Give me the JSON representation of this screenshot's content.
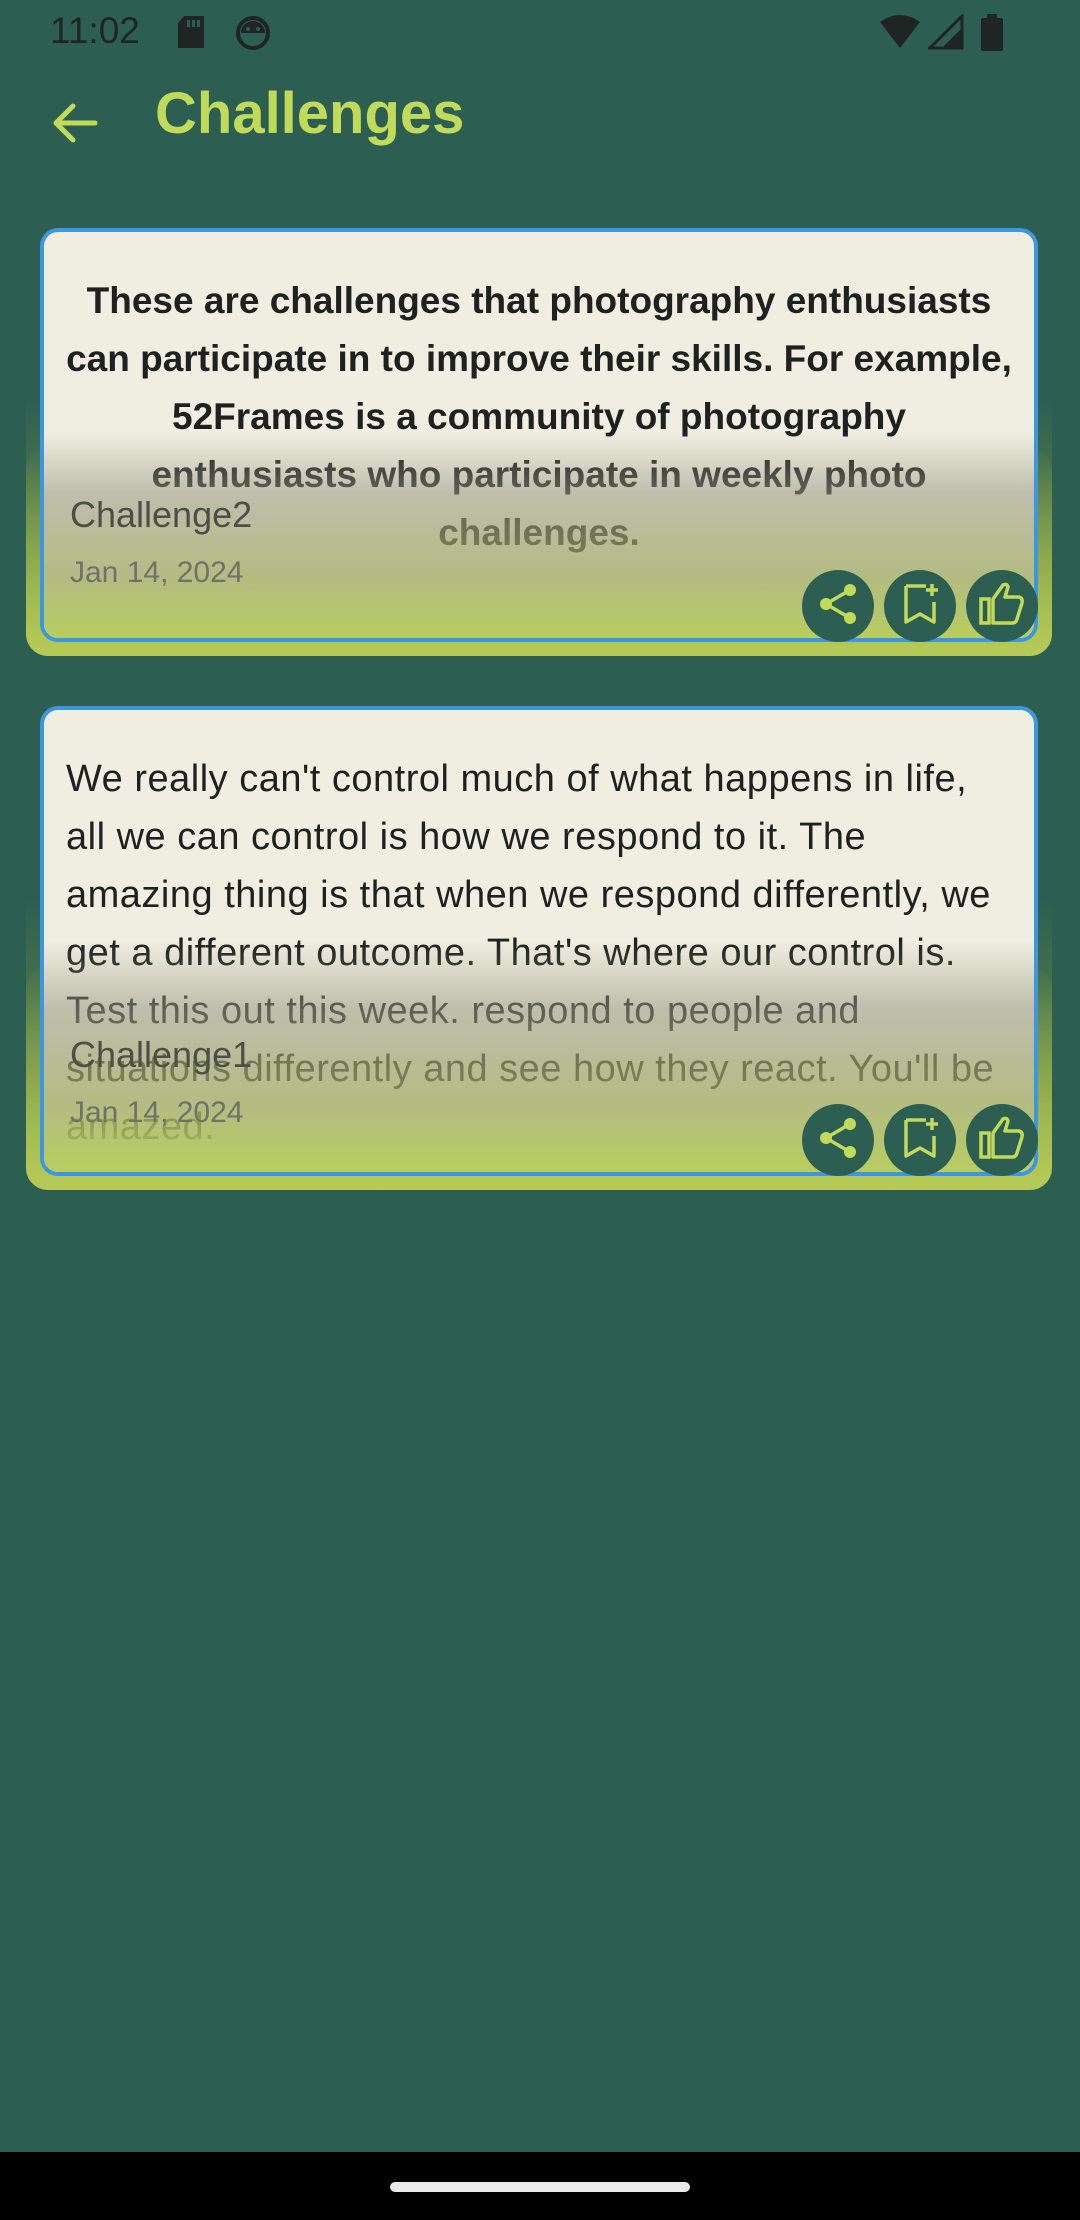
{
  "status_bar": {
    "time": "11:02",
    "icons": [
      "sd-card-icon",
      "android-debug-icon",
      "wifi-icon",
      "signal-icon",
      "battery-icon"
    ]
  },
  "app_bar": {
    "title": "Challenges",
    "back_icon": "arrow-left-icon"
  },
  "cards": [
    {
      "body": "These are challenges that photography enthusiasts can participate in to improve their skills. For example, 52Frames is a community of photography enthusiasts who participate in weekly photo challenges.",
      "title": "Challenge2",
      "date": "Jan 14, 2024",
      "actions": [
        "share-icon",
        "bookmark-add-icon",
        "thumb-up-icon"
      ]
    },
    {
      "body": "We really can't control much of what happens in life, all we can control is how we respond to it. The amazing thing is that when we respond differently, we get a different outcome. That's where our control is. Test this out this week. respond to people and situations differently and see how they react. You'll be amazed.",
      "title": "Challenge1",
      "date": "Jan 14, 2024",
      "actions": [
        "share-icon",
        "bookmark-add-icon",
        "thumb-up-icon"
      ]
    }
  ],
  "colors": {
    "background": "#2c5f52",
    "accent": "#c2da5a",
    "card_border": "#3c97e0",
    "card_surface": "#efeee0"
  }
}
